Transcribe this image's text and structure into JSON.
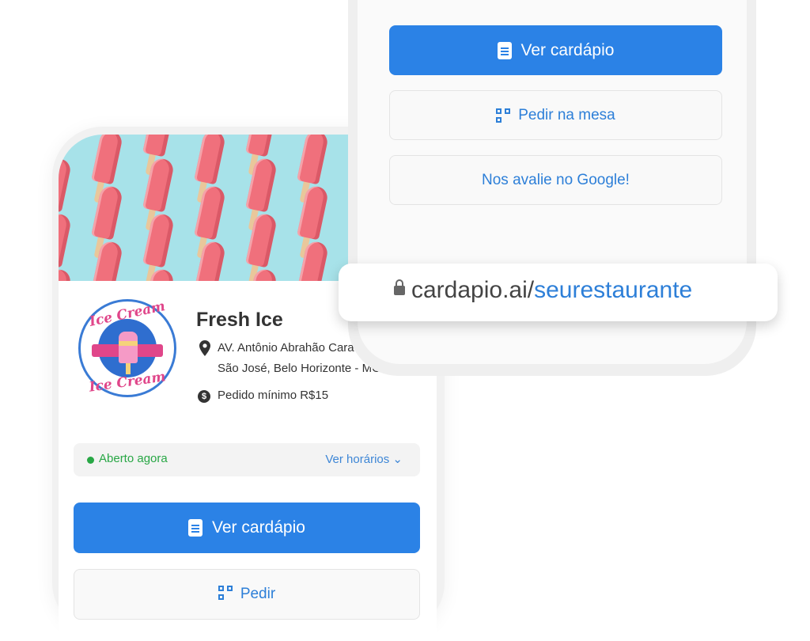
{
  "restaurant": {
    "name": "Fresh Ice",
    "address_line1": "AV. Antônio Abrahão Cara",
    "address_line2": "São José, Belo Horizonte - MG",
    "min_order": "Pedido mínimo R$15",
    "logo_text_top": "Ice Cream",
    "logo_text_bottom": "Ice Cream"
  },
  "hours": {
    "status": "Aberto agora",
    "link": "Ver horários ⌄"
  },
  "actions": {
    "menu_label": "Ver cardápio",
    "table_order_label": "Pedir na mesa",
    "review_label": "Nos avalie no Google!",
    "back_partial_label": "Pedir"
  },
  "url": {
    "domain": "cardapio.ai/",
    "path": "seurestaurante"
  },
  "icons": {
    "menu": "menu-book-icon",
    "qr": "qr-code-icon",
    "lock": "lock-icon",
    "pin": "map-pin-icon",
    "money": "dollar-icon"
  },
  "colors": {
    "primary": "#2b82e6",
    "open_green": "#28a745",
    "banner": "#a7e2e9",
    "popsicle": "#f0707c"
  }
}
